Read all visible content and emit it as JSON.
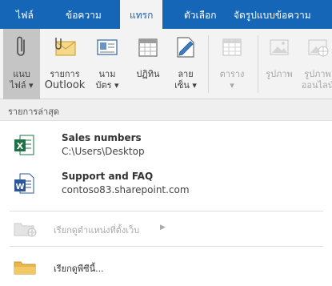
{
  "tabs": [
    {
      "label": "ไฟล์"
    },
    {
      "label": "ข้อความ"
    },
    {
      "label": "แทรก"
    },
    {
      "label": "ตัวเลือก"
    },
    {
      "label": "จัดรูปแบบข้อความ"
    }
  ],
  "ribbon": {
    "attach_file": {
      "label1": "แนบ",
      "label2": "ไฟล์ ▾"
    },
    "outlook_item": {
      "label1": "รายการ",
      "label2": "Outlook"
    },
    "business_card": {
      "label1": "นาม",
      "label2": "บัตร ▾"
    },
    "calendar": {
      "label1": "ปฏิทิน"
    },
    "signature": {
      "label1": "ลาย",
      "label2": "เซ็น ▾"
    },
    "table": {
      "label1": "ตาราง",
      "label2": "▾"
    },
    "pictures": {
      "label1": "รูปภาพ"
    },
    "online_pictures": {
      "label1": "รูปภาพ",
      "label2": "ออนไลน์"
    }
  },
  "dropdown": {
    "heading": "รายการล่าสุด",
    "recent": [
      {
        "title": "Sales numbers",
        "path": "C:\\Users\\Desktop",
        "type": "excel"
      },
      {
        "title": "Support and FAQ",
        "path": "contoso83.sharepoint.com",
        "type": "word"
      }
    ],
    "browse_web": "เรียกดูตำแหน่งที่ตั้งเว็บ",
    "browse_pc": "เรียกดูพีซีนี้..."
  },
  "colors": {
    "accent": "#1566b7",
    "excel": "#1e7145",
    "word": "#2b579a",
    "folder": "#e8b64a"
  }
}
